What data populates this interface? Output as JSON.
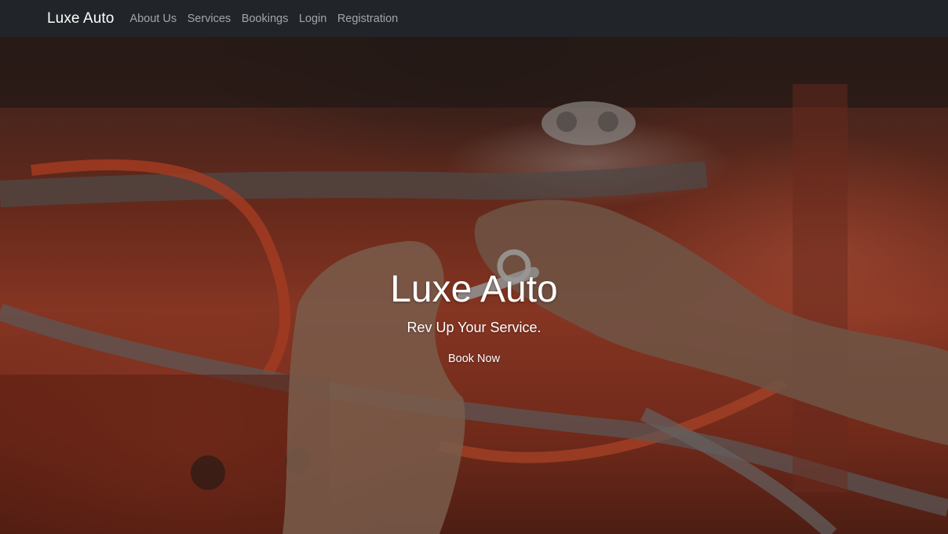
{
  "navbar": {
    "brand": "Luxe Auto",
    "links": [
      {
        "label": "About Us"
      },
      {
        "label": "Services"
      },
      {
        "label": "Bookings"
      },
      {
        "label": "Login"
      },
      {
        "label": "Registration"
      }
    ]
  },
  "hero": {
    "title": "Luxe Auto",
    "tagline": "Rev Up Your Service.",
    "cta_label": "Book Now",
    "background_image": "photo of hands working on an orange engine with a wrench"
  },
  "colors": {
    "navbar_bg": "#212529",
    "nav_text": "#ffffff",
    "hero_accent": "#b94a30"
  }
}
